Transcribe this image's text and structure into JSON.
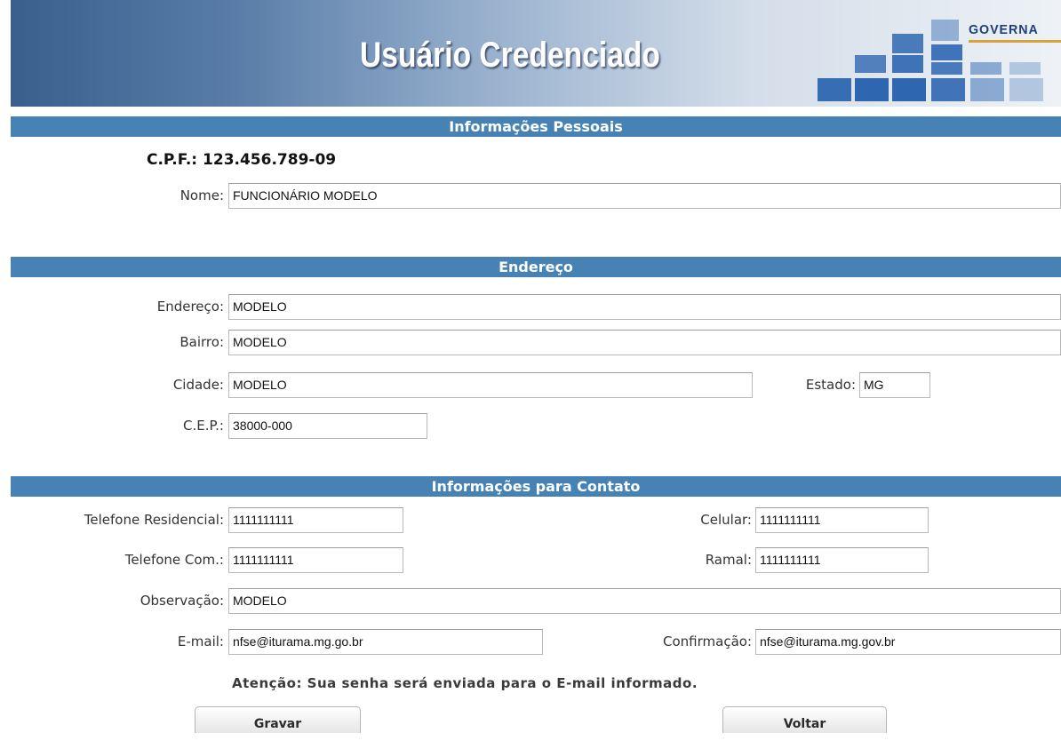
{
  "banner": {
    "title": "Usuário Credenciado",
    "logo_text": "GOVERNA"
  },
  "sections": {
    "personal": "Informações Pessoais",
    "address": "Endereço",
    "contact": "Informações para Contato"
  },
  "personal": {
    "cpf_label": "C.P.F.:",
    "cpf_value": "123.456.789-09",
    "nome_label": "Nome:",
    "nome_value": "FUNCIONÁRIO MODELO"
  },
  "address": {
    "endereco_label": "Endereço:",
    "endereco_value": "MODELO",
    "bairro_label": "Bairro:",
    "bairro_value": "MODELO",
    "cidade_label": "Cidade:",
    "cidade_value": "MODELO",
    "estado_label": "Estado:",
    "estado_value": "MG",
    "cep_label": "C.E.P.:",
    "cep_value": "38000-000"
  },
  "contact": {
    "tel_res_label": "Telefone Residencial:",
    "tel_res_value": "1111111111",
    "celular_label": "Celular:",
    "celular_value": "1111111111",
    "tel_com_label": "Telefone Com.:",
    "tel_com_value": "1111111111",
    "ramal_label": "Ramal:",
    "ramal_value": "1111111111",
    "obs_label": "Observação:",
    "obs_value": "MODELO",
    "email_label": "E-mail:",
    "email_value": "nfse@iturama.mg.go.br",
    "confirm_label": "Confirmação:",
    "confirm_value": "nfse@iturama.mg.gov.br"
  },
  "notice": "Atenção: Sua senha será enviada para o E-mail informado.",
  "buttons": {
    "save": "Gravar",
    "back": "Voltar"
  },
  "colors": {
    "section_bar": "#4682b4",
    "banner_dark": "#3a5f8d",
    "tile_blue": "#2e66b0"
  }
}
